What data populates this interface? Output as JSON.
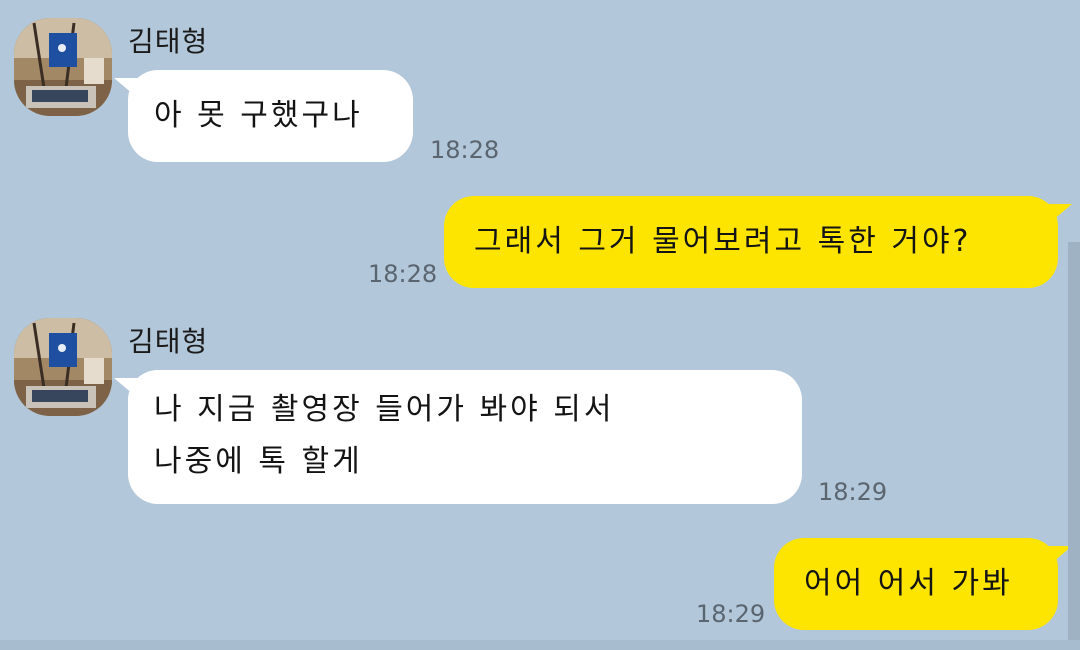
{
  "chat": {
    "messages": [
      {
        "sender": "김태형",
        "text": "아 못 구했구나",
        "time": "18:28"
      },
      {
        "text": "그래서 그거 물어보려고 톡한 거야?",
        "time": "18:28"
      },
      {
        "sender": "김태형",
        "lines": [
          "나 지금 촬영장 들어가 봐야 되서",
          "나중에 톡 할게"
        ],
        "time": "18:29"
      },
      {
        "text": "어어 어서 가봐",
        "time": "18:29"
      }
    ]
  }
}
